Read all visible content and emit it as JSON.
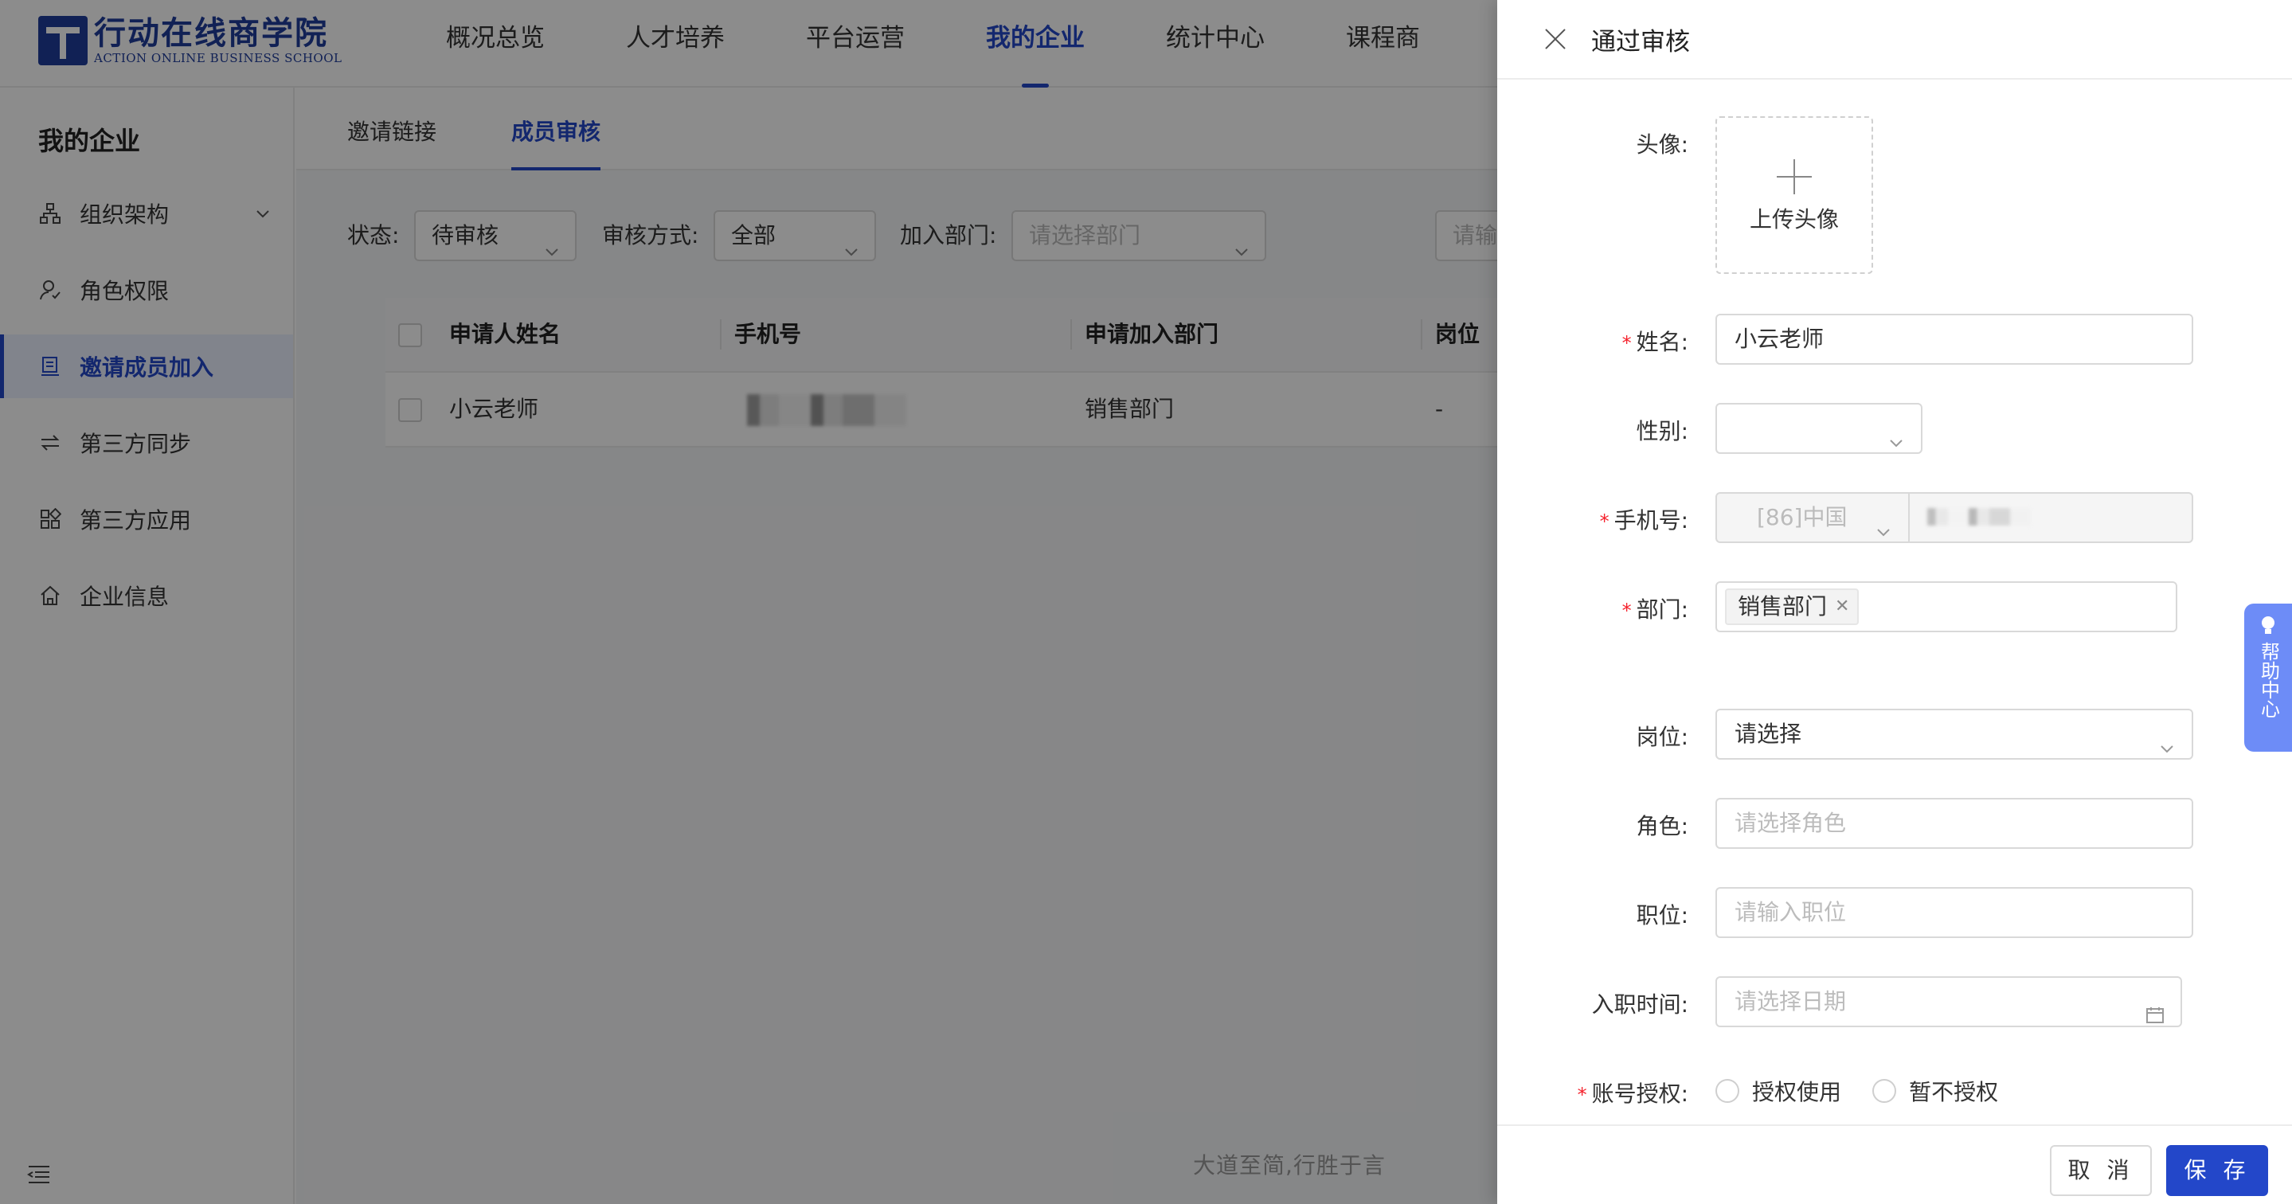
{
  "brand": {
    "name_cn": "行动在线商学院",
    "name_en": "ACTION ONLINE BUSINESS SCHOOL",
    "color": "#1f3c9c"
  },
  "nav": {
    "items": [
      {
        "label": "概况总览"
      },
      {
        "label": "人才培养"
      },
      {
        "label": "平台运营"
      },
      {
        "label": "我的企业",
        "active": true
      },
      {
        "label": "统计中心"
      },
      {
        "label": "课程商"
      }
    ]
  },
  "sidebar": {
    "title": "我的企业",
    "items": [
      {
        "label": "组织架构",
        "icon": "org-chart-icon",
        "expandable": true
      },
      {
        "label": "角色权限",
        "icon": "user-role-icon"
      },
      {
        "label": "邀请成员加入",
        "icon": "invite-doc-icon",
        "active": true
      },
      {
        "label": "第三方同步",
        "icon": "sync-arrows-icon"
      },
      {
        "label": "第三方应用",
        "icon": "apps-grid-icon"
      },
      {
        "label": "企业信息",
        "icon": "home-icon"
      }
    ]
  },
  "tabs": [
    {
      "label": "邀请链接"
    },
    {
      "label": "成员审核",
      "active": true
    }
  ],
  "filters": {
    "status_label": "状态:",
    "status_value": "待审核",
    "method_label": "审核方式:",
    "method_value": "全部",
    "dept_label": "加入部门:",
    "dept_placeholder": "请选择部门",
    "search_placeholder": "请输"
  },
  "table": {
    "columns": [
      "申请人姓名",
      "手机号",
      "申请加入部门",
      "岗位"
    ],
    "rows": [
      {
        "name": "小云老师",
        "phone": "",
        "dept": "销售部门",
        "post": "-"
      }
    ]
  },
  "footer_text": "大道至简,行胜于言",
  "drawer": {
    "title": "通过审核",
    "avatar_label": "头像:",
    "upload_label": "上传头像",
    "name_label": "姓名:",
    "name_value": "小云老师",
    "gender_label": "性别:",
    "gender_value": "",
    "phone_label": "手机号:",
    "phone_country": "[86]中国",
    "dept_label": "部门:",
    "dept_tag": "销售部门",
    "post_label": "岗位:",
    "post_value": "请选择",
    "role_label": "角色:",
    "role_placeholder": "请选择角色",
    "title_label": "职位:",
    "title_placeholder": "请输入职位",
    "join_label": "入职时间:",
    "join_placeholder": "请选择日期",
    "auth_label": "账号授权:",
    "auth_options": [
      "授权使用",
      "暂不授权"
    ],
    "cancel_label": "取 消",
    "save_label": "保 存"
  },
  "help_label": "帮助中心",
  "colors": {
    "primary": "#2347c9",
    "required": "#f5222d",
    "help": "#6d8cf7"
  }
}
